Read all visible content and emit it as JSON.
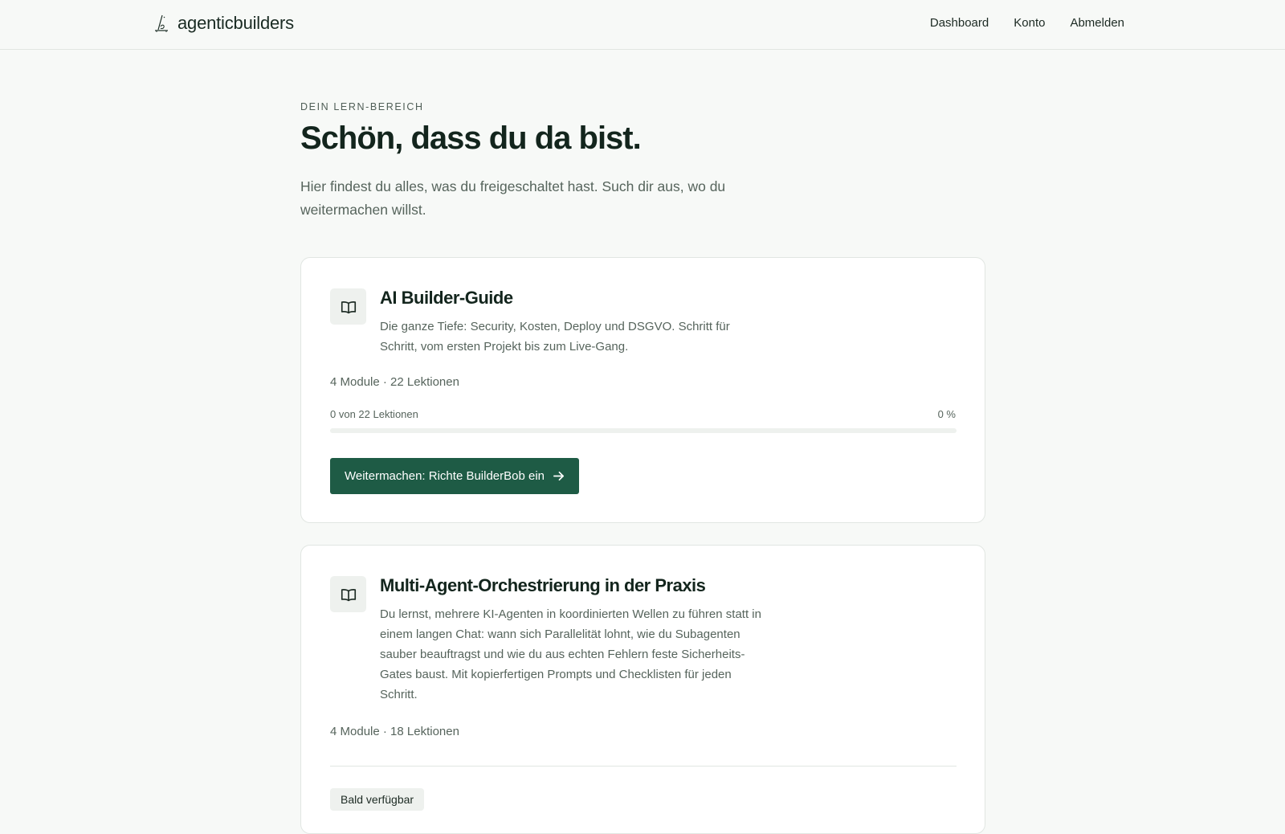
{
  "header": {
    "brand_name": "agenticbuilders",
    "brand_icon": "book-quill-icon",
    "nav": [
      {
        "label": "Dashboard"
      },
      {
        "label": "Konto"
      },
      {
        "label": "Abmelden"
      }
    ]
  },
  "main": {
    "eyebrow": "DEIN LERN-BEREICH",
    "title": "Schön, dass du da bist.",
    "intro": "Hier findest du alles, was du freigeschaltet hast. Such dir aus, wo du weitermachen willst."
  },
  "courses": [
    {
      "icon": "open-book-icon",
      "title": "AI Builder-Guide",
      "description": "Die ganze Tiefe: Security, Kosten, Deploy und DSGVO. Schritt für Schritt, vom ersten Projekt bis zum Live-Gang.",
      "meta": "4 Module · 22 Lektionen",
      "progress_label": "0 von 22 Lektionen",
      "progress_percent_label": "0 %",
      "progress_fraction": 0,
      "cta_label": "Weitermachen: Richte BuilderBob ein"
    },
    {
      "icon": "open-book-icon",
      "title": "Multi-Agent-Orchestrierung in der Praxis",
      "description": "Du lernst, mehrere KI-Agenten in koordinierten Wellen zu führen statt in einem langen Chat: wann sich Parallelität lohnt, wie du Subagenten sauber beauftragst und wie du aus echten Fehlern feste Sicherheits-Gates baust. Mit kopierfertigen Prompts und Checklisten für jeden Schritt.",
      "meta": "4 Module · 18 Lektionen",
      "status_badge": "Bald verfügbar"
    }
  ],
  "colors": {
    "accent": "#1e5b45",
    "background": "#f7f9f7",
    "card": "#ffffff",
    "text": "#13251d",
    "muted": "#56645c"
  }
}
